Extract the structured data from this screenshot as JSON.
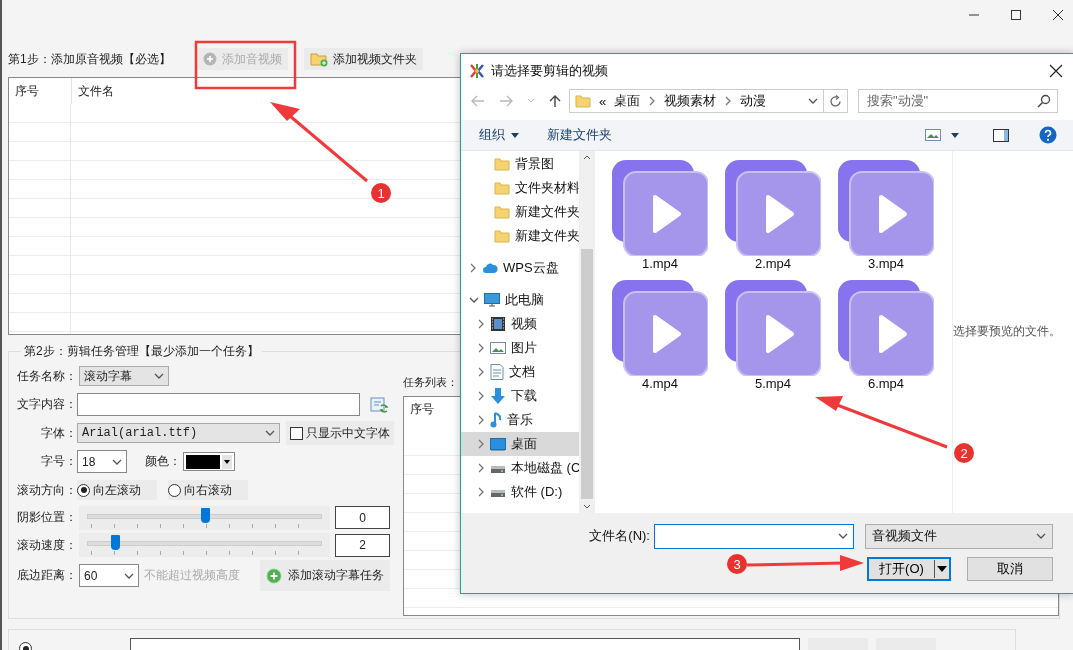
{
  "step1": {
    "title": "第1步：添加原音视频【必选】",
    "buttons": [
      {
        "label": "添加音视频",
        "disabled": true
      },
      {
        "label": "添加视频文件夹",
        "disabled": false
      }
    ],
    "table": {
      "columns": [
        "序号",
        "文件名"
      ]
    }
  },
  "step2": {
    "title": "第2步：剪辑任务管理【最少添加一个任务】",
    "task_name": {
      "label": "任务名称：",
      "value": "滚动字幕"
    },
    "text_content": {
      "label": "文字内容："
    },
    "font": {
      "label": "字体：",
      "value": "Arial(arial.ttf)"
    },
    "chinese_only": {
      "label": "只显示中文字体",
      "checked": false
    },
    "font_size": {
      "label": "字号：",
      "value": "18"
    },
    "font_color": {
      "label": "颜色：",
      "color": "#000000"
    },
    "direction": {
      "label": "滚动方向：",
      "options": [
        {
          "label": "向左滚动",
          "selected": true
        },
        {
          "label": "向右滚动",
          "selected": false
        }
      ]
    },
    "sliders": [
      {
        "label": "阴影位置：",
        "level": 0.5,
        "reading": "0"
      },
      {
        "label": "滚动速度：",
        "level": 0.12,
        "reading": "2"
      }
    ],
    "bottom_margin": {
      "label": "底边距离：",
      "value": "60",
      "note": "不能超过视频高度"
    },
    "add_button": {
      "label": "添加滚动字幕任务"
    },
    "task_list": {
      "label": "任务列表：",
      "columns": [
        "序号"
      ]
    }
  },
  "dialog": {
    "title": "请选择要剪辑的视频",
    "path_overflow": "«",
    "path": [
      "桌面",
      "视频素材",
      "动漫"
    ],
    "search": {
      "placeholder": "搜索\"动漫\""
    },
    "toolbar": [
      {
        "label": "组织",
        "kind": "menu"
      },
      {
        "label": "新建文件夹",
        "kind": "button"
      }
    ],
    "quick_items": [
      {
        "label": "背景图",
        "selected": false
      },
      {
        "label": "文件夹材料",
        "selected": false
      },
      {
        "label": "新建文件夹",
        "selected": false
      },
      {
        "label": "新建文件夹",
        "selected": false
      }
    ],
    "tree": [
      {
        "label": "WPS云盘",
        "kind": "cloud",
        "expanded": false,
        "selected": false
      },
      {
        "label": "此电脑",
        "kind": "computer",
        "expanded": true,
        "selected": false,
        "children": [
          {
            "label": "视频",
            "kind": "videos",
            "expanded": false,
            "selected": false
          },
          {
            "label": "图片",
            "kind": "pictures",
            "expanded": false,
            "selected": false
          },
          {
            "label": "文档",
            "kind": "documents",
            "expanded": false,
            "selected": false
          },
          {
            "label": "下载",
            "kind": "downloads",
            "expanded": false,
            "selected": false
          },
          {
            "label": "音乐",
            "kind": "music",
            "expanded": false,
            "selected": false
          },
          {
            "label": "桌面",
            "kind": "desktop",
            "expanded": false,
            "selected": true
          },
          {
            "label": "本地磁盘 (C",
            "kind": "disk",
            "expanded": false,
            "selected": false
          },
          {
            "label": "软件 (D:)",
            "kind": "disk",
            "expanded": false,
            "selected": false
          }
        ]
      }
    ],
    "files": [
      {
        "name": "1.mp4"
      },
      {
        "name": "2.mp4"
      },
      {
        "name": "3.mp4"
      },
      {
        "name": "4.mp4"
      },
      {
        "name": "5.mp4"
      },
      {
        "name": "6.mp4"
      }
    ],
    "preview_hint": "选择要预览的文件。",
    "file_name": {
      "label": "文件名(N):"
    },
    "file_type": {
      "value": "音视频文件"
    },
    "buttons": [
      {
        "label": "打开(O)",
        "kind": "split"
      },
      {
        "label": "取消",
        "kind": "plain"
      }
    ]
  },
  "output_option": {
    "selected": true
  },
  "annotations": [
    {
      "number": "1"
    },
    {
      "number": "2"
    },
    {
      "number": "3"
    }
  ]
}
